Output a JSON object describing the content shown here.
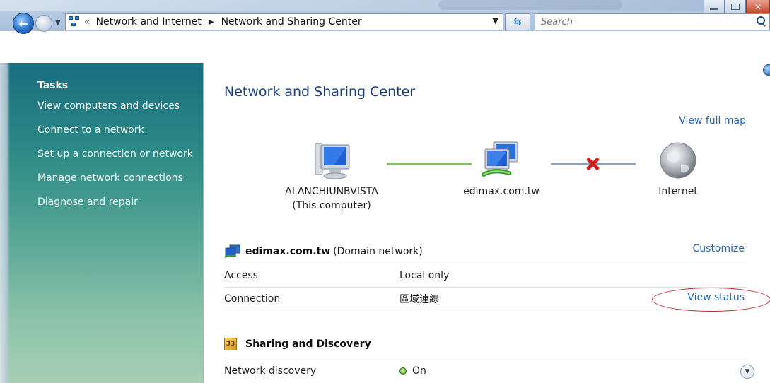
{
  "address": {
    "chevron": "«",
    "crumbs": [
      "Network and Internet",
      "Network and Sharing Center"
    ]
  },
  "search": {
    "placeholder": "Search"
  },
  "tasks": {
    "heading": "Tasks",
    "items": [
      "View computers and devices",
      "Connect to a network",
      "Set up a connection or network",
      "Manage network connections",
      "Diagnose and repair"
    ]
  },
  "main": {
    "title": "Network and Sharing Center",
    "view_full_map": "View full map",
    "map": {
      "computer_name": "ALANCHIUNBVISTA",
      "computer_sub": "(This computer)",
      "network_name": "edimax.com.tw",
      "internet_label": "Internet"
    },
    "network": {
      "name": "edimax.com.tw",
      "type": "(Domain network)",
      "customize": "Customize",
      "rows": [
        {
          "label": "Access",
          "value": "Local only"
        },
        {
          "label": "Connection",
          "value": "區域連線"
        }
      ],
      "view_status": "View status"
    },
    "sharing": {
      "title": "Sharing and Discovery",
      "rows": [
        {
          "label": "Network discovery",
          "value": "On"
        }
      ]
    }
  },
  "colors": {
    "link": "#1f65b5",
    "title": "#1a3e82",
    "highlight_circle": "#c0282d",
    "disconnect": "#d01f1f"
  }
}
